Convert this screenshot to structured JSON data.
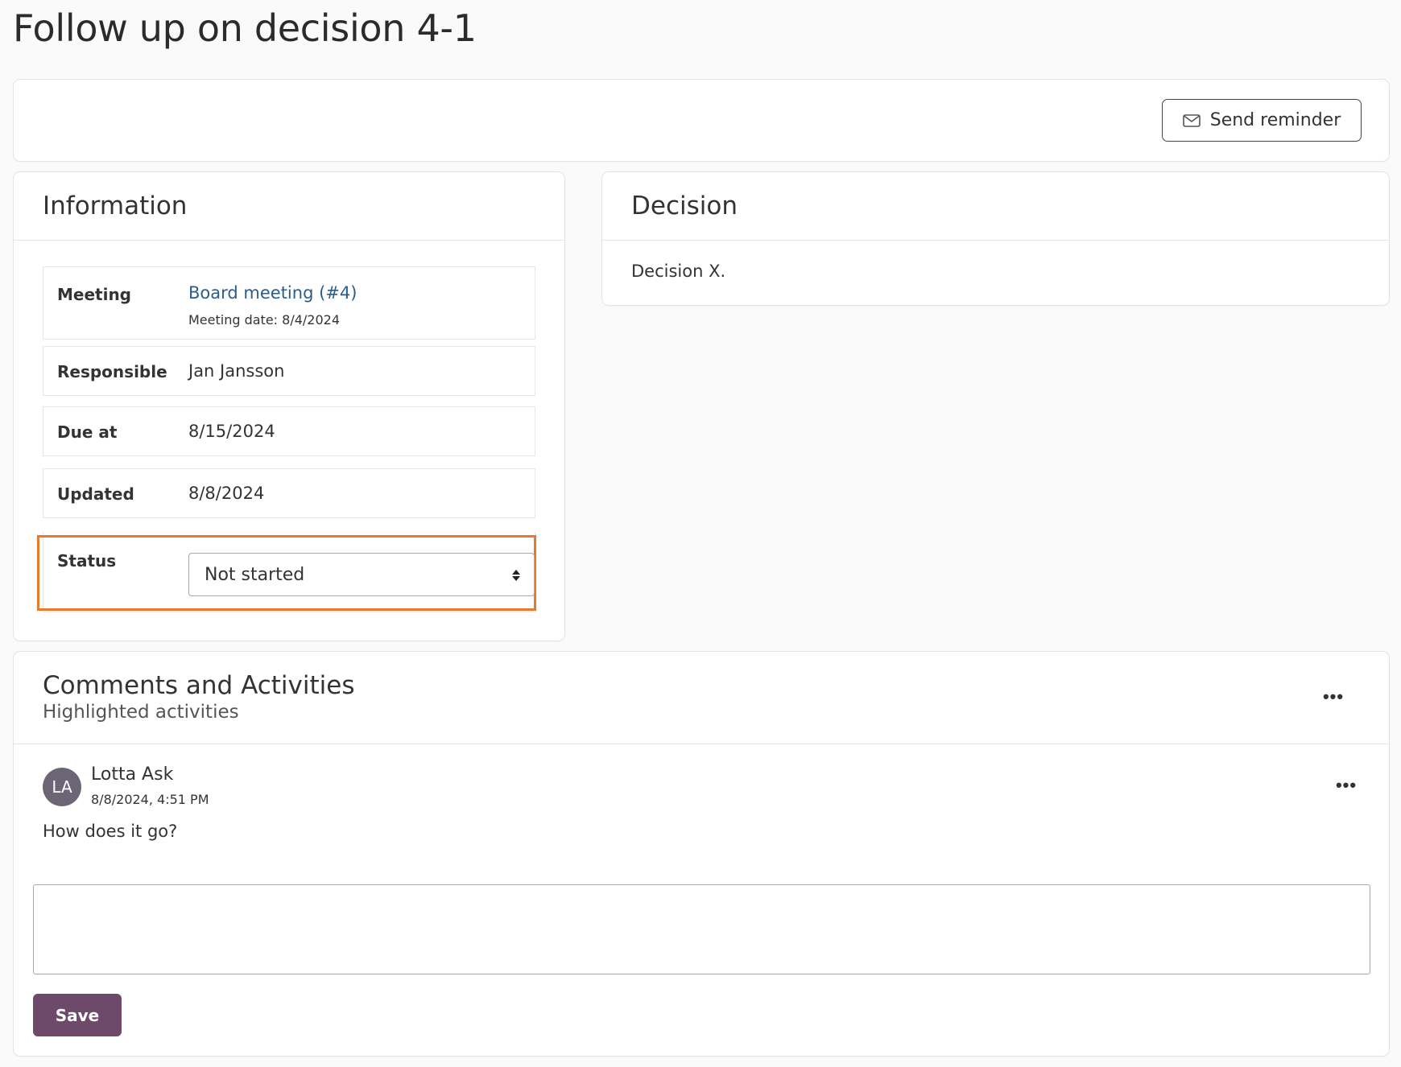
{
  "page": {
    "title": "Follow up on decision 4-1"
  },
  "toolbar": {
    "send_reminder_label": "Send reminder",
    "send_reminder_icon": "envelope-icon"
  },
  "information": {
    "title": "Information",
    "meeting": {
      "label": "Meeting",
      "link_text": "Board meeting (#4)",
      "date_text": "Meeting date: 8/4/2024"
    },
    "responsible": {
      "label": "Responsible",
      "value": "Jan Jansson"
    },
    "due_at": {
      "label": "Due at",
      "value": "8/15/2024"
    },
    "updated": {
      "label": "Updated",
      "value": "8/8/2024"
    },
    "status": {
      "label": "Status",
      "selected": "Not started",
      "highlight_color": "#e8792f"
    }
  },
  "decision": {
    "title": "Decision",
    "text": "Decision X."
  },
  "comments": {
    "title": "Comments and Activities",
    "subtitle": "Highlighted activities",
    "more_icon": "ellipsis-icon",
    "items": [
      {
        "initials": "LA",
        "author": "Lotta Ask",
        "timestamp": "8/8/2024, 4:51 PM",
        "text": "How does it go?"
      }
    ],
    "input_value": "",
    "save_label": "Save"
  },
  "colors": {
    "link": "#2d5c8a",
    "save_button": "#6e4a6a",
    "avatar": "#6b6575"
  }
}
